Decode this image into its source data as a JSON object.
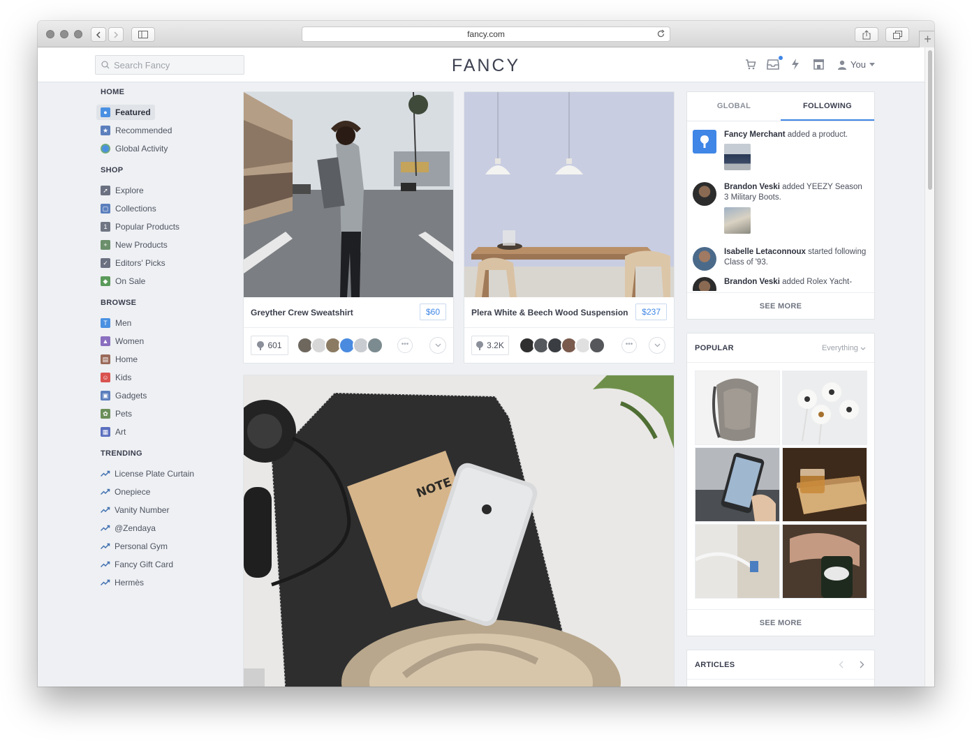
{
  "browser": {
    "url": "fancy.com"
  },
  "header": {
    "logo": "FANCY",
    "search_placeholder": "Search Fancy",
    "user_label": "You"
  },
  "sidebar": {
    "home": {
      "title": "HOME",
      "items": [
        "Featured",
        "Recommended",
        "Global Activity"
      ]
    },
    "shop": {
      "title": "SHOP",
      "items": [
        "Explore",
        "Collections",
        "Popular Products",
        "New Products",
        "Editors' Picks",
        "On Sale"
      ]
    },
    "browse": {
      "title": "BROWSE",
      "items": [
        "Men",
        "Women",
        "Home",
        "Kids",
        "Gadgets",
        "Pets",
        "Art"
      ]
    },
    "trending": {
      "title": "TRENDING",
      "items": [
        "License Plate Curtain",
        "Onepiece",
        "Vanity Number",
        "@Zendaya",
        "Personal Gym",
        "Fancy Gift Card",
        "Hermès"
      ]
    }
  },
  "cards": [
    {
      "title": "Greyther Crew Sweatshirt",
      "price": "$60",
      "fancy_count": "601"
    },
    {
      "title": "Plera White & Beech Wood Suspension L",
      "price": "$237",
      "fancy_count": "3.2K"
    }
  ],
  "activity": {
    "tabs": [
      "GLOBAL",
      "FOLLOWING"
    ],
    "active_tab": "FOLLOWING",
    "items": [
      {
        "user": "Fancy Merchant",
        "text": "added a product."
      },
      {
        "user": "Brandon Veski",
        "text": "added YEEZY Season 3 Military Boots."
      },
      {
        "user": "Isabelle Letaconnoux",
        "text": "started following Class of '93."
      },
      {
        "user": "Brandon Veski",
        "text": "added Rolex Yacht-"
      }
    ],
    "see_more": "SEE MORE"
  },
  "popular": {
    "title": "POPULAR",
    "filter": "Everything",
    "see_more": "SEE MORE"
  },
  "articles": {
    "title": "ARTICLES"
  },
  "colors": {
    "accent": "#3f86e6",
    "text": "#393d4d",
    "page_bg": "#eef0f3"
  }
}
